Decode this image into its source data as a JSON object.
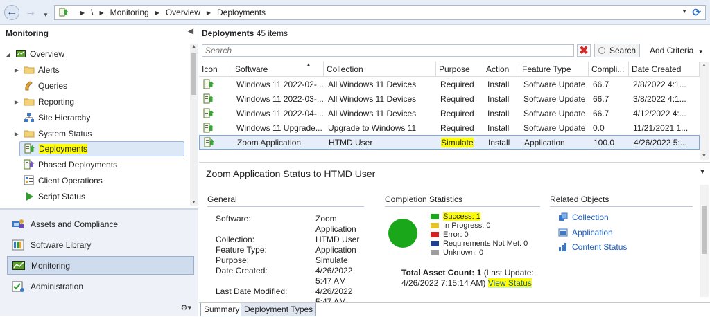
{
  "address_bar": {
    "root": "\\",
    "crumbs": [
      "Monitoring",
      "Overview",
      "Deployments"
    ]
  },
  "left": {
    "header": "Monitoring",
    "tree": [
      {
        "label": "Overview",
        "icon": "overview-icon"
      },
      {
        "label": "Alerts",
        "icon": "folder-icon"
      },
      {
        "label": "Queries",
        "icon": "queries-icon"
      },
      {
        "label": "Reporting",
        "icon": "folder-icon"
      },
      {
        "label": "Site Hierarchy",
        "icon": "hierarchy-icon"
      },
      {
        "label": "System Status",
        "icon": "folder-icon"
      },
      {
        "label": "Deployments",
        "icon": "deployment-icon"
      },
      {
        "label": "Phased Deployments",
        "icon": "phased-deployment-icon"
      },
      {
        "label": "Client Operations",
        "icon": "client-operations-icon"
      },
      {
        "label": "Script Status",
        "icon": "script-status-icon"
      }
    ],
    "workspaces": [
      {
        "label": "Assets and Compliance"
      },
      {
        "label": "Software Library"
      },
      {
        "label": "Monitoring"
      },
      {
        "label": "Administration"
      }
    ]
  },
  "list": {
    "title": "Deployments",
    "count": "45 items",
    "search_placeholder": "Search",
    "search_button": "Search",
    "add_criteria": "Add Criteria",
    "columns": [
      "Icon",
      "Software",
      "Collection",
      "Purpose",
      "Action",
      "Feature Type",
      "Compli...",
      "Date Created"
    ],
    "rows": [
      {
        "software": "Windows 11 2022-02-...",
        "collection": "All Windows 11 Devices",
        "purpose": "Required",
        "action": "Install",
        "feature": "Software Update",
        "compliance": "66.7",
        "date": "2/8/2022 4:1..."
      },
      {
        "software": "Windows 11 2022-03-...",
        "collection": "All Windows 11 Devices",
        "purpose": "Required",
        "action": "Install",
        "feature": "Software Update",
        "compliance": "66.7",
        "date": "3/8/2022 4:1..."
      },
      {
        "software": "Windows 11 2022-04-...",
        "collection": "All Windows 11 Devices",
        "purpose": "Required",
        "action": "Install",
        "feature": "Software Update",
        "compliance": "66.7",
        "date": "4/12/2022 4:..."
      },
      {
        "software": "Windows 11 Upgrade...",
        "collection": "Upgrade to Windows 11",
        "purpose": "Required",
        "action": "Install",
        "feature": "Software Update",
        "compliance": "0.0",
        "date": "11/21/2021 1..."
      },
      {
        "software": "Zoom Application",
        "collection": "HTMD User",
        "purpose": "Simulate",
        "action": "Install",
        "feature": "Application",
        "compliance": "100.0",
        "date": "4/26/2022 5:..."
      }
    ]
  },
  "details": {
    "title": "Zoom Application Status to HTMD User",
    "general": {
      "header": "General",
      "fields": [
        {
          "label": "Software:",
          "value": "Zoom Application"
        },
        {
          "label": "Collection:",
          "value": "HTMD User"
        },
        {
          "label": "Feature Type:",
          "value": "Application"
        },
        {
          "label": "Purpose:",
          "value": "Simulate"
        },
        {
          "label": "Date Created:",
          "value": "4/26/2022 5:47 AM"
        },
        {
          "label": "Last Date Modified:",
          "value": "4/26/2022 5:47 AM"
        }
      ]
    },
    "completion": {
      "header": "Completion Statistics",
      "stats": [
        {
          "label": "Success: 1",
          "color": "#1aa81a"
        },
        {
          "label": "In Progress: 0",
          "color": "#e6c229"
        },
        {
          "label": "Error: 0",
          "color": "#d42020"
        },
        {
          "label": "Requirements Not Met: 0",
          "color": "#1f3f8f"
        },
        {
          "label": "Unknown: 0",
          "color": "#9e9e9e"
        }
      ],
      "total_label": "Total Asset Count: 1",
      "last_update": "(Last Update: 4/26/2022 7:15:14 AM)",
      "view_status": "View Status"
    },
    "related": {
      "header": "Related Objects",
      "links": [
        "Collection",
        "Application",
        "Content Status"
      ]
    },
    "tabs": [
      "Summary",
      "Deployment Types"
    ]
  }
}
